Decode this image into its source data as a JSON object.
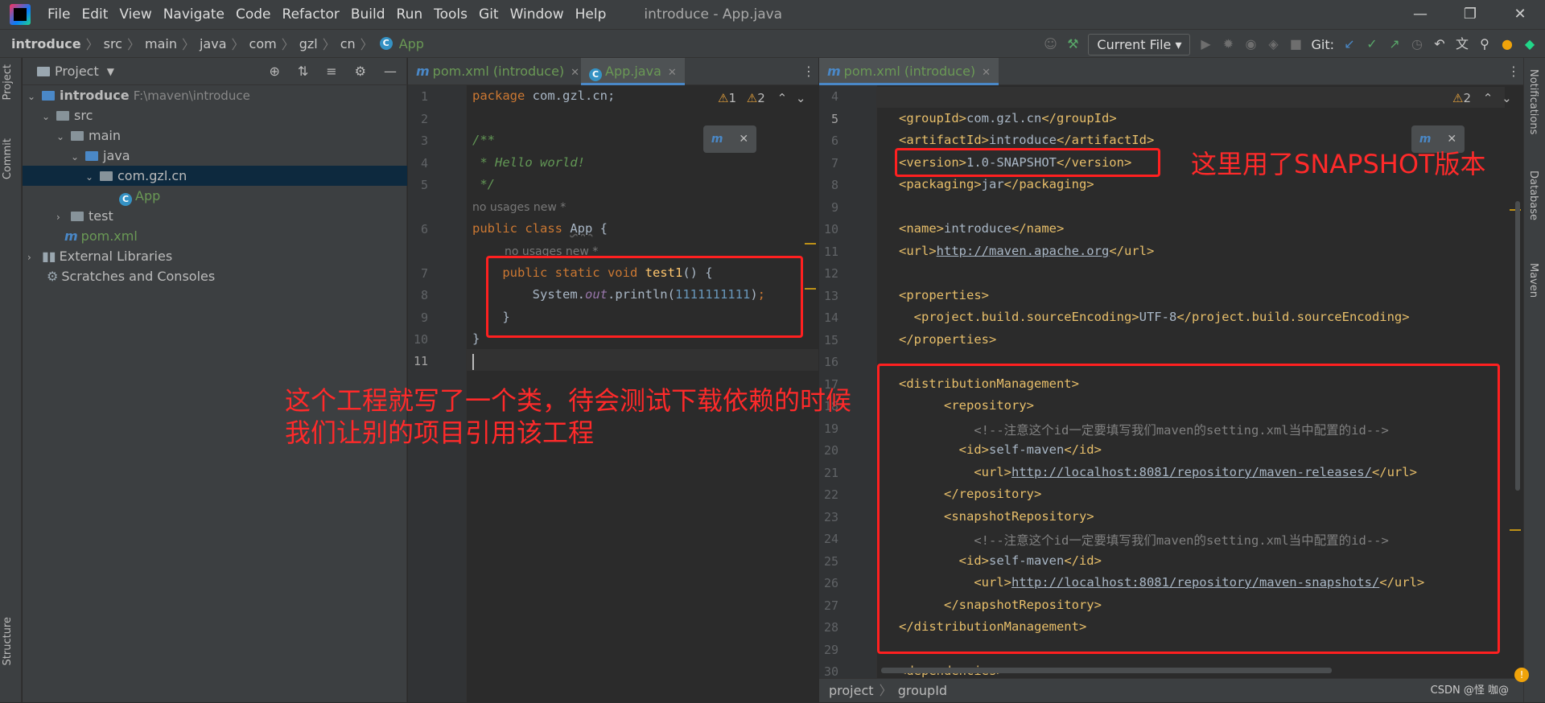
{
  "menubar": {
    "items": [
      "File",
      "Edit",
      "View",
      "Navigate",
      "Code",
      "Refactor",
      "Build",
      "Run",
      "Tools",
      "Git",
      "Window",
      "Help"
    ],
    "title": "introduce - App.java"
  },
  "navbar": {
    "crumbs": [
      "introduce",
      "src",
      "main",
      "java",
      "com",
      "gzl",
      "cn",
      "App"
    ],
    "run_config": "Current File",
    "git_label": "Git:"
  },
  "sidebar": {
    "project": "Project",
    "commit": "Commit",
    "structure": "Structure",
    "notifications": "Notifications",
    "database": "Database",
    "maven": "Maven"
  },
  "project_panel": {
    "title": "Project",
    "tree": [
      {
        "label": "introduce",
        "extra": "F:\\maven\\introduce"
      },
      {
        "label": "src"
      },
      {
        "label": "main"
      },
      {
        "label": "java"
      },
      {
        "label": "com.gzl.cn"
      },
      {
        "label": "App"
      },
      {
        "label": "test"
      },
      {
        "label": "pom.xml"
      },
      {
        "label": "External Libraries"
      },
      {
        "label": "Scratches and Consoles"
      }
    ]
  },
  "editor_left": {
    "tabs": [
      "pom.xml (introduce)",
      "App.java"
    ],
    "warnings": "1",
    "weak_warnings": "2",
    "hint1": "no usages   new *",
    "hint2": "no usages   new *",
    "line_numbers": [
      "1",
      "2",
      "3",
      "4",
      "5",
      "",
      "6",
      "",
      "7",
      "8",
      "9",
      "10",
      "11"
    ]
  },
  "editor_right": {
    "tabs": [
      "pom.xml (introduce)"
    ],
    "weak_warnings": "2",
    "line_numbers": [
      "4",
      "5",
      "6",
      "7",
      "8",
      "9",
      "10",
      "11",
      "12",
      "13",
      "14",
      "15",
      "16",
      "17",
      "18",
      "19",
      "20",
      "21",
      "22",
      "23",
      "24",
      "25",
      "26",
      "27",
      "28",
      "29",
      "30"
    ]
  },
  "annotations": {
    "snapshot": "这里用了SNAPSHOT版本",
    "project_line1": "这个工程就写了一个类，待会测试下载依赖的时候",
    "project_line2": "我们让别的项目引用该工程"
  },
  "statusbar": {
    "crumb1": "project",
    "crumb2": "groupId",
    "watermark": "CSDN @怪 咖@"
  },
  "colors": {
    "annotation_red": "#ff2020",
    "keyword": "#cc7832",
    "tag": "#e8bf6a",
    "comment": "#629755",
    "accent": "#4a88c7"
  }
}
